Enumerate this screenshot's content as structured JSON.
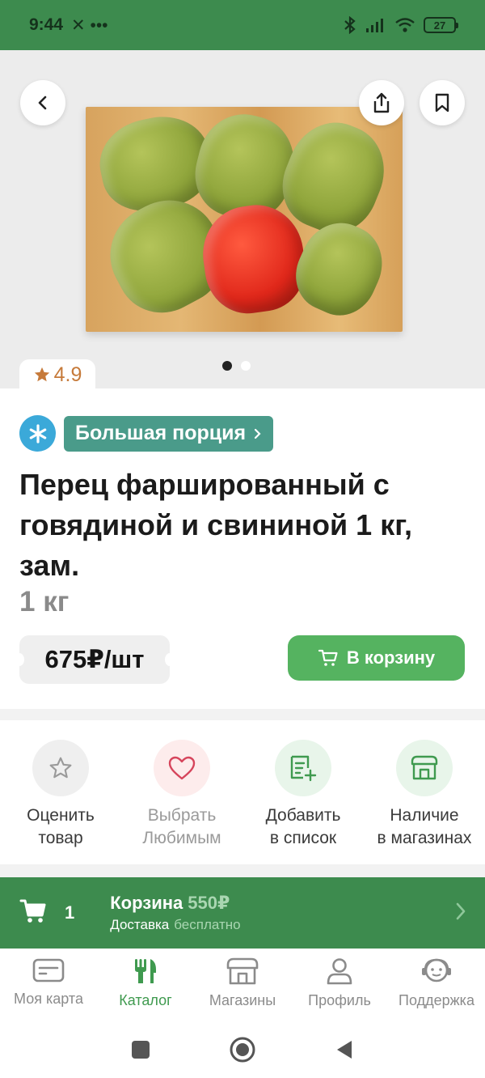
{
  "status_bar": {
    "time": "9:44",
    "extra": "✕ •••",
    "battery": "27"
  },
  "hero": {
    "rating": "4.9",
    "slide_index": 1,
    "slide_count": 2
  },
  "product": {
    "badge": "Большая порция",
    "title": "Перец фаршированный с говядиной и свининой 1 кг, зам.",
    "weight": "1 кг",
    "price": "675₽/шт",
    "add_to_cart": "В корзину"
  },
  "actions": [
    {
      "label": "Оценить\nтовар",
      "icon": "star-icon"
    },
    {
      "label": "Выбрать\nЛюбимым",
      "icon": "heart-icon"
    },
    {
      "label": "Добавить\nв список",
      "icon": "list-add-icon"
    },
    {
      "label": "Наличие\nв магазинах",
      "icon": "store-icon"
    }
  ],
  "cart_bar": {
    "count": "1",
    "title": "Корзина",
    "total": "550₽",
    "delivery_label": "Доставка",
    "delivery_value": "бесплатно"
  },
  "bottom_nav": [
    {
      "label": "Моя карта",
      "icon": "card-icon"
    },
    {
      "label": "Каталог",
      "icon": "cutlery-icon",
      "active": true
    },
    {
      "label": "Магазины",
      "icon": "store-icon"
    },
    {
      "label": "Профиль",
      "icon": "profile-icon"
    },
    {
      "label": "Поддержка",
      "icon": "support-icon"
    }
  ],
  "colors": {
    "brand_green": "#3d8b4e",
    "button_green": "#55b360",
    "badge_teal": "#4a9b8a",
    "rating_orange": "#c67a3a"
  }
}
